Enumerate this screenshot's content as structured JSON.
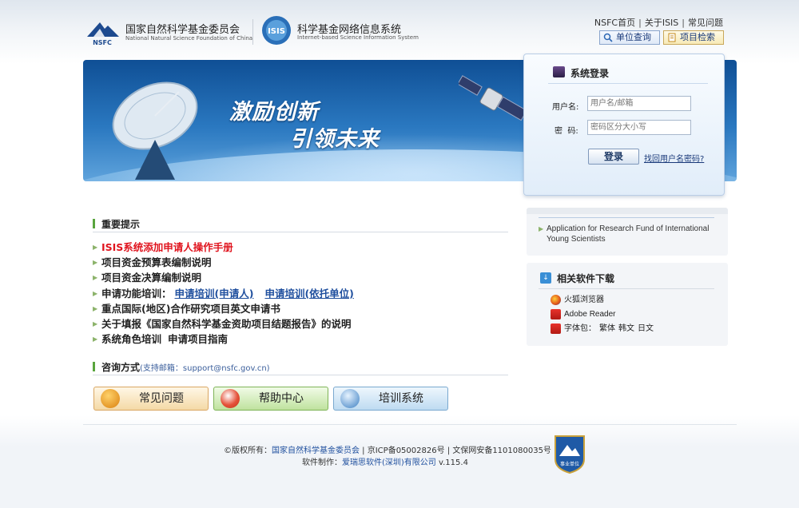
{
  "header": {
    "logo1_cn": "国家自然科学基金委员会",
    "logo1_en": "National Natural Science Foundation of China",
    "logo1_mark": "NSFC",
    "logo2_cn": "科学基金网络信息系统",
    "logo2_en": "Internet-based Science Information System",
    "logo2_mark": "ISIS",
    "links": [
      "NSFC首页",
      "关于ISIS",
      "常见问题"
    ],
    "link_separator": "|",
    "unit_query": "单位查询",
    "project_search": "项目检索"
  },
  "banner": {
    "slogan_line1": "激励创新",
    "slogan_line2": "引领未来"
  },
  "login": {
    "title": "系统登录",
    "username_label": "用户名:",
    "username_placeholder": "用户名/邮箱",
    "password_label": "密  码:",
    "password_placeholder": "密码区分大小写",
    "submit": "登录",
    "forgot": "找回用户名密码?"
  },
  "notices": {
    "title": "重要提示",
    "items": [
      "ISIS系统添加申请人操作手册",
      "项目资金预算表编制说明",
      "项目资金决算编制说明",
      "申请功能培训：",
      "重点国际(地区)合作研究项目英文申请书",
      "关于填报《国家自然科学基金资助项目结题报告》的说明",
      "系统角色培训"
    ],
    "training_links": [
      "申请培训(申请人)",
      "申请培训(依托单位)"
    ],
    "guide_link": "申请项目指南"
  },
  "contact": {
    "title": "咨询方式",
    "email_note": "(支持邮箱：support@nsfc.gov.cn)"
  },
  "quick_buttons": {
    "faq": "常见问题",
    "help": "帮助中心",
    "training": "培训系统"
  },
  "young_scientists": {
    "text": "Application for Research Fund of International Young Scientists"
  },
  "software": {
    "title": "相关软件下载",
    "firefox": "火狐浏览器",
    "reader": "Adobe Reader",
    "fonts_label": "字体包：",
    "fonts": [
      "繁体",
      "韩文",
      "日文"
    ]
  },
  "footer": {
    "copyright_prefix": "©版权所有：",
    "org": "国家自然科学基金委员会",
    "icp": " | 京ICP备05002826号 | 文保网安备1101080035号",
    "maker_prefix": "软件制作：",
    "maker": "爱瑞思软件(深圳)有限公司",
    "version": " v.115.4",
    "badge_text": "事业单位"
  },
  "colors": {
    "notice_red": "#e0141e",
    "link_blue": "#1f4f9e",
    "banner_blue": "#1a5ea8",
    "accent_green": "#59a53d"
  }
}
